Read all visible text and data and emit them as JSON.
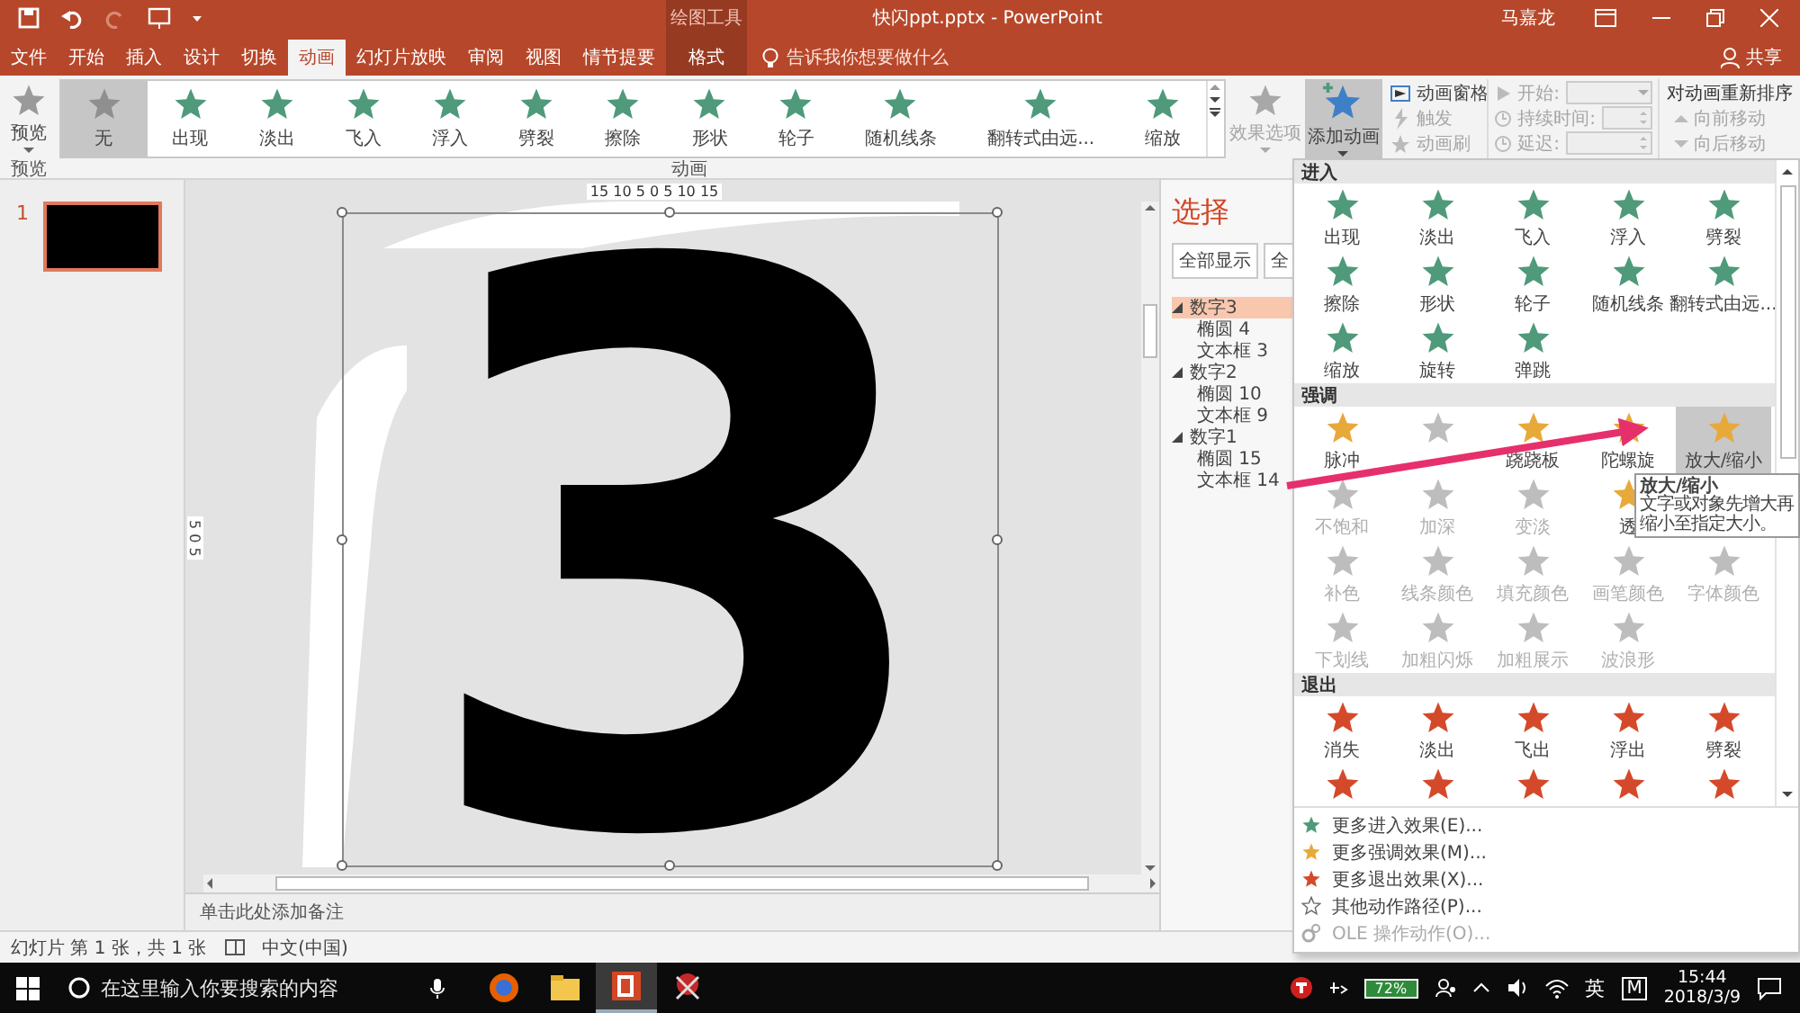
{
  "title_bar": {
    "contextual_group": "绘图工具",
    "title": "快闪ppt.pptx - PowerPoint",
    "user": "马嘉龙"
  },
  "tabs": [
    {
      "label": "文件",
      "kind": "normal",
      "selected": false
    },
    {
      "label": "开始",
      "kind": "normal",
      "selected": false
    },
    {
      "label": "插入",
      "kind": "normal",
      "selected": false
    },
    {
      "label": "设计",
      "kind": "normal",
      "selected": false
    },
    {
      "label": "切换",
      "kind": "normal",
      "selected": false
    },
    {
      "label": "动画",
      "kind": "normal",
      "selected": true
    },
    {
      "label": "幻灯片放映",
      "kind": "normal",
      "selected": false
    },
    {
      "label": "审阅",
      "kind": "normal",
      "selected": false
    },
    {
      "label": "视图",
      "kind": "normal",
      "selected": false
    },
    {
      "label": "情节提要",
      "kind": "normal",
      "selected": false
    },
    {
      "label": "格式",
      "kind": "contextual",
      "selected": false
    }
  ],
  "tell_me": {
    "placeholder": "告诉我你想要做什么"
  },
  "share": "共享",
  "ribbon": {
    "preview": {
      "label": "预览",
      "group": "预览"
    },
    "gallery": {
      "group": "动画",
      "items": [
        {
          "label": "无",
          "selected": true
        },
        {
          "label": "出现",
          "selected": false
        },
        {
          "label": "淡出",
          "selected": false
        },
        {
          "label": "飞入",
          "selected": false
        },
        {
          "label": "浮入",
          "selected": false
        },
        {
          "label": "劈裂",
          "selected": false
        },
        {
          "label": "擦除",
          "selected": false
        },
        {
          "label": "形状",
          "selected": false
        },
        {
          "label": "轮子",
          "selected": false
        },
        {
          "label": "随机线条",
          "selected": false
        },
        {
          "label": "翻转式由远...",
          "selected": false
        },
        {
          "label": "缩放",
          "selected": false
        }
      ]
    },
    "effect_options": {
      "label": "效果选项",
      "disabled": true
    },
    "add_animation": {
      "label": "添加动画",
      "pressed": true
    },
    "advanced": [
      {
        "label": "动画窗格",
        "disabled": false
      },
      {
        "label": "触发",
        "disabled": true
      },
      {
        "label": "动画刷",
        "disabled": true
      }
    ],
    "timing": [
      {
        "label": "开始:",
        "kind": "dropdown",
        "disabled": true
      },
      {
        "label": "持续时间:",
        "kind": "spinner",
        "disabled": true
      },
      {
        "label": "延迟:",
        "kind": "spinner",
        "disabled": true
      }
    ],
    "reorder": {
      "title": "对动画重新排序",
      "items": [
        {
          "label": "向前移动",
          "disabled": true
        },
        {
          "label": "向后移动",
          "disabled": true
        }
      ]
    }
  },
  "thumbnails": [
    {
      "number": "1",
      "selected": true
    }
  ],
  "editor": {
    "ruler_top": "15 10 5 0 5 10 15",
    "ruler_left": "5 0 5",
    "digit": "3",
    "notes_placeholder": "单击此处添加备注"
  },
  "selection_pane": {
    "title": "选择",
    "buttons": [
      "全部显示",
      "全"
    ],
    "tree": [
      {
        "label": "数字3",
        "selected": true,
        "expanded": true,
        "children": [
          {
            "label": "椭圆 4",
            "selected": false
          },
          {
            "label": "文本框 3",
            "selected": false
          }
        ]
      },
      {
        "label": "数字2",
        "selected": false,
        "expanded": true,
        "children": [
          {
            "label": "椭圆 10",
            "selected": false
          },
          {
            "label": "文本框 9",
            "selected": false
          }
        ]
      },
      {
        "label": "数字1",
        "selected": false,
        "expanded": true,
        "children": [
          {
            "label": "椭圆 15",
            "selected": false
          },
          {
            "label": "文本框 14",
            "selected": false
          }
        ]
      }
    ]
  },
  "effects_menu": {
    "sections": [
      {
        "title": "进入",
        "kind": "entrance",
        "rows": [
          [
            {
              "label": "出现",
              "disabled": false,
              "selected": false
            },
            {
              "label": "淡出",
              "disabled": false,
              "selected": false
            },
            {
              "label": "飞入",
              "disabled": false,
              "selected": false
            },
            {
              "label": "浮入",
              "disabled": false,
              "selected": false
            },
            {
              "label": "劈裂",
              "disabled": false,
              "selected": false
            }
          ],
          [
            {
              "label": "擦除",
              "disabled": false,
              "selected": false
            },
            {
              "label": "形状",
              "disabled": false,
              "selected": false
            },
            {
              "label": "轮子",
              "disabled": false,
              "selected": false
            },
            {
              "label": "随机线条",
              "disabled": false,
              "selected": false
            },
            {
              "label": "翻转式由远...",
              "disabled": false,
              "selected": false
            }
          ],
          [
            {
              "label": "缩放",
              "disabled": false,
              "selected": false
            },
            {
              "label": "旋转",
              "disabled": false,
              "selected": false
            },
            {
              "label": "弹跳",
              "disabled": false,
              "selected": false
            }
          ]
        ]
      },
      {
        "title": "强调",
        "kind": "emphasis",
        "rows": [
          [
            {
              "label": "脉冲",
              "disabled": false,
              "selected": false
            },
            {
              "disabled": true,
              "selected": false
            },
            {
              "label": "跷跷板",
              "disabled": false,
              "selected": false
            },
            {
              "label": "陀螺旋",
              "disabled": false,
              "selected": false
            },
            {
              "label": "放大/缩小",
              "disabled": false,
              "selected": true
            }
          ],
          [
            {
              "label": "不饱和",
              "disabled": true,
              "selected": false
            },
            {
              "label": "加深",
              "disabled": true,
              "selected": false
            },
            {
              "label": "变淡",
              "disabled": true,
              "selected": false
            },
            {
              "label": "透",
              "disabled": false,
              "selected": false
            }
          ],
          [
            {
              "label": "补色",
              "disabled": true,
              "selected": false
            },
            {
              "label": "线条颜色",
              "disabled": true,
              "selected": false
            },
            {
              "label": "填充颜色",
              "disabled": true,
              "selected": false
            },
            {
              "label": "画笔颜色",
              "disabled": true,
              "selected": false
            },
            {
              "label": "字体颜色",
              "disabled": true,
              "selected": false
            }
          ],
          [
            {
              "label": "下划线",
              "disabled": true,
              "selected": false
            },
            {
              "label": "加粗闪烁",
              "disabled": true,
              "selected": false
            },
            {
              "label": "加粗展示",
              "disabled": true,
              "selected": false
            },
            {
              "label": "波浪形",
              "disabled": true,
              "selected": false
            }
          ]
        ]
      },
      {
        "title": "退出",
        "kind": "exit",
        "rows": [
          [
            {
              "label": "消失",
              "disabled": false,
              "selected": false
            },
            {
              "label": "淡出",
              "disabled": false,
              "selected": false
            },
            {
              "label": "飞出",
              "disabled": false,
              "selected": false
            },
            {
              "label": "浮出",
              "disabled": false,
              "selected": false
            },
            {
              "label": "劈裂",
              "disabled": false,
              "selected": false
            }
          ],
          [
            {
              "disabled": false,
              "selected": false
            },
            {
              "disabled": false,
              "selected": false
            },
            {
              "disabled": false,
              "selected": false
            },
            {
              "disabled": false,
              "selected": false
            },
            {
              "disabled": false,
              "selected": false
            }
          ]
        ]
      }
    ],
    "commands": [
      {
        "label": "更多进入效果(E)...",
        "kind": "entrance",
        "disabled": false
      },
      {
        "label": "更多强调效果(M)...",
        "kind": "emphasis",
        "disabled": false
      },
      {
        "label": "更多退出效果(X)...",
        "kind": "exit",
        "disabled": false
      },
      {
        "label": "其他动作路径(P)...",
        "kind": "path",
        "disabled": false
      },
      {
        "label": "OLE 操作动作(O)...",
        "kind": "ole",
        "disabled": true
      }
    ],
    "tooltip": {
      "title": "放大/缩小",
      "text": "文字或对象先增大再缩小至指定大小。"
    }
  },
  "status_bar": {
    "slide_info": "幻灯片 第 1 张，共 1 张",
    "language": "中文(中国)"
  },
  "taskbar": {
    "search_placeholder": "在这里输入你要搜索的内容",
    "battery": "72%",
    "ime": "英",
    "ime_mode": "M",
    "time": "15:44",
    "date": "2018/3/9"
  }
}
